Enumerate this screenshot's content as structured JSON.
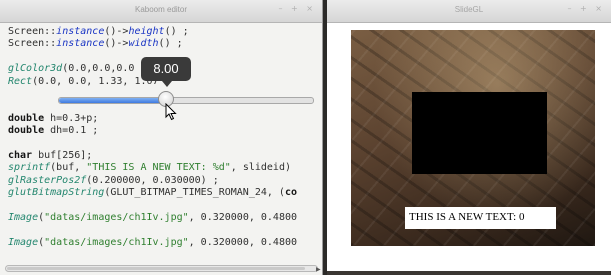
{
  "editor": {
    "title": "Kaboom editor",
    "window_controls": "– + ×",
    "lines": [
      [
        {
          "t": "Screen::",
          "c": "plain"
        },
        {
          "t": "instance",
          "c": "it-blue"
        },
        {
          "t": "()->",
          "c": "plain"
        },
        {
          "t": "height",
          "c": "it-blue"
        },
        {
          "t": "() ;",
          "c": "plain"
        }
      ],
      [
        {
          "t": "Screen::",
          "c": "plain"
        },
        {
          "t": "instance",
          "c": "it-blue"
        },
        {
          "t": "()->",
          "c": "plain"
        },
        {
          "t": "width",
          "c": "it-blue"
        },
        {
          "t": "() ;",
          "c": "plain"
        }
      ],
      [
        {
          "t": "",
          "c": "plain"
        }
      ],
      [
        {
          "t": "glColor3d",
          "c": "it-teal"
        },
        {
          "t": "(0.0,0.0,0.0",
          "c": "plain"
        }
      ],
      [
        {
          "t": "Rect",
          "c": "it-teal"
        },
        {
          "t": "(0.0, 0.0, 1.33, 1.0",
          "c": "plain"
        },
        {
          "t": "7 ;",
          "c": "plain"
        }
      ],
      [
        {
          "t": "",
          "c": "plain"
        }
      ],
      [
        {
          "t": "",
          "c": "plain"
        }
      ],
      [
        {
          "t": "double",
          "c": "kw"
        },
        {
          "t": " h=0.3+p;",
          "c": "plain"
        }
      ],
      [
        {
          "t": "double",
          "c": "kw"
        },
        {
          "t": " dh=0.1 ;",
          "c": "plain"
        }
      ],
      [
        {
          "t": "",
          "c": "plain"
        }
      ],
      [
        {
          "t": "char",
          "c": "kw"
        },
        {
          "t": " buf[256];",
          "c": "plain"
        }
      ],
      [
        {
          "t": "sprintf",
          "c": "it-teal"
        },
        {
          "t": "(buf, ",
          "c": "plain"
        },
        {
          "t": "\"THIS IS A NEW TEXT: %d\"",
          "c": "str"
        },
        {
          "t": ", slideid)",
          "c": "plain"
        }
      ],
      [
        {
          "t": "glRasterPos2f",
          "c": "it-teal"
        },
        {
          "t": "(0.200000, 0.030000) ;",
          "c": "plain"
        }
      ],
      [
        {
          "t": "glutBitmapString",
          "c": "it-teal"
        },
        {
          "t": "(GLUT_BITMAP_TIMES_ROMAN_24, (",
          "c": "plain"
        },
        {
          "t": "co",
          "c": "kw"
        }
      ],
      [
        {
          "t": "",
          "c": "plain"
        }
      ],
      [
        {
          "t": "Image",
          "c": "it-teal"
        },
        {
          "t": "(",
          "c": "plain"
        },
        {
          "t": "\"datas/images/ch1Iv.jpg\"",
          "c": "str"
        },
        {
          "t": ", 0.320000, 0.4800",
          "c": "plain"
        }
      ],
      [
        {
          "t": "",
          "c": "plain"
        }
      ],
      [
        {
          "t": "Image",
          "c": "it-teal"
        },
        {
          "t": "(",
          "c": "plain"
        },
        {
          "t": "\"datas/images/ch1Iv.jpg\"",
          "c": "str"
        },
        {
          "t": ", 0.320000, 0.4800",
          "c": "plain"
        }
      ]
    ],
    "slider": {
      "tooltip": "8.00",
      "fraction": 0.42
    }
  },
  "viewer": {
    "title": "SlideGL",
    "window_controls": "– + ×",
    "caption": "THIS IS A NEW TEXT: 0"
  }
}
